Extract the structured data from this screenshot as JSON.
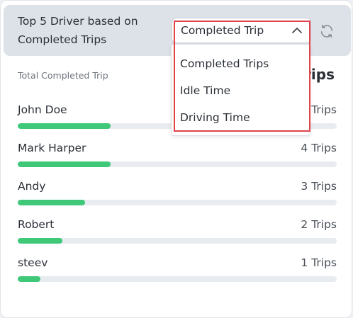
{
  "header": {
    "title": "Top 5 Driver based on Completed Trips",
    "refresh_icon": "refresh-icon"
  },
  "summary": {
    "label": "Total Completed Trip",
    "value_visible": "rips"
  },
  "metric_select": {
    "selected": "Completed Trip",
    "expanded": true,
    "chevron_icon": "chevron-up-icon",
    "options": [
      "Completed Trips",
      "Idle Time",
      "Driving Time"
    ]
  },
  "drivers": [
    {
      "name": "John Doe",
      "count_label": "Trips",
      "progress": 0.29
    },
    {
      "name": "Mark Harper",
      "count_label": "4 Trips",
      "progress": 0.29
    },
    {
      "name": "Andy",
      "count_label": "3 Trips",
      "progress": 0.21
    },
    {
      "name": "Robert",
      "count_label": "2 Trips",
      "progress": 0.14
    },
    {
      "name": "steev",
      "count_label": "1 Trips",
      "progress": 0.07
    }
  ],
  "colors": {
    "header_bg": "#dde2e8",
    "progress_fill": "#3ec878",
    "progress_track": "#e8ebef",
    "highlight_border": "#e0424a"
  }
}
